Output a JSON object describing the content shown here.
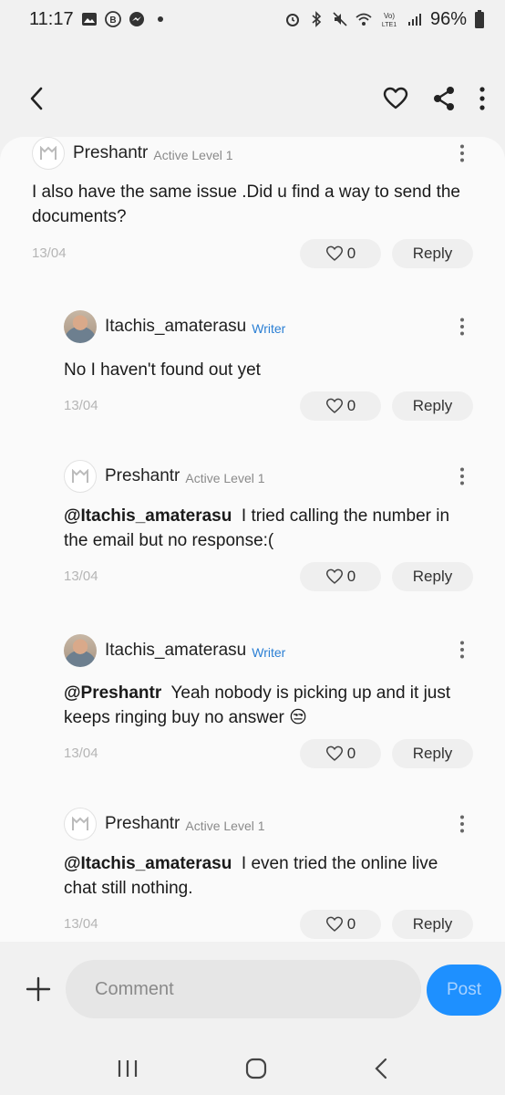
{
  "status_bar": {
    "time": "11:17",
    "battery": "96%"
  },
  "app_bar": {
    "back_icon": "chevron-left-icon",
    "like_icon": "heart-icon",
    "share_icon": "share-icon",
    "more_icon": "more-vertical-icon"
  },
  "comments": [
    {
      "username": "Preshantr",
      "rank": "Active Level 1",
      "mention": "",
      "text": "I also have the same issue .Did u find a way to send the documents?",
      "date": "13/04",
      "likes": "0",
      "reply_label": "Reply"
    },
    {
      "username": "Itachis_amaterasu",
      "rank": "Writer",
      "mention": "",
      "text": "No I haven't found out yet",
      "date": "13/04",
      "likes": "0",
      "reply_label": "Reply"
    },
    {
      "username": "Preshantr",
      "rank": "Active Level 1",
      "mention": "@Itachis_amaterasu",
      "text": "I tried calling the number in the email but no response:(",
      "date": "13/04",
      "likes": "0",
      "reply_label": "Reply"
    },
    {
      "username": "Itachis_amaterasu",
      "rank": "Writer",
      "mention": "@Preshantr",
      "text": "Yeah nobody is picking up and it just keeps ringing buy no answer 😒",
      "date": "13/04",
      "likes": "0",
      "reply_label": "Reply"
    },
    {
      "username": "Preshantr",
      "rank": "Active Level 1",
      "mention": "@Itachis_amaterasu",
      "text": "I even tried the online live chat still nothing.",
      "date": "13/04",
      "likes": "0",
      "reply_label": "Reply"
    }
  ],
  "composer": {
    "placeholder": "Comment",
    "post_label": "Post"
  },
  "colors": {
    "accent": "#1e90ff",
    "writer_badge": "#2b7fd4"
  }
}
